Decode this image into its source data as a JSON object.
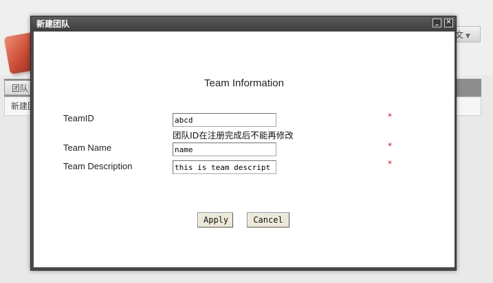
{
  "background": {
    "language_label": "文",
    "tab_label": "团队",
    "row_label": "新建团"
  },
  "modal": {
    "title": "新建团队",
    "form": {
      "heading": "Team Information",
      "team_id": {
        "label": "TeamID",
        "value": "abcd",
        "hint": "团队ID在注册完成后不能再修改",
        "required": "*"
      },
      "team_name": {
        "label": "Team Name",
        "value": "name",
        "required": "*"
      },
      "team_description": {
        "label": "Team Description",
        "value": "this is team descript",
        "required": "*"
      }
    },
    "buttons": {
      "apply": "Apply",
      "cancel": "Cancel"
    }
  },
  "colors": {
    "titlebar": "#4b4b4b",
    "required_marker": "#dd1111",
    "button_face": "#ece9d8"
  }
}
